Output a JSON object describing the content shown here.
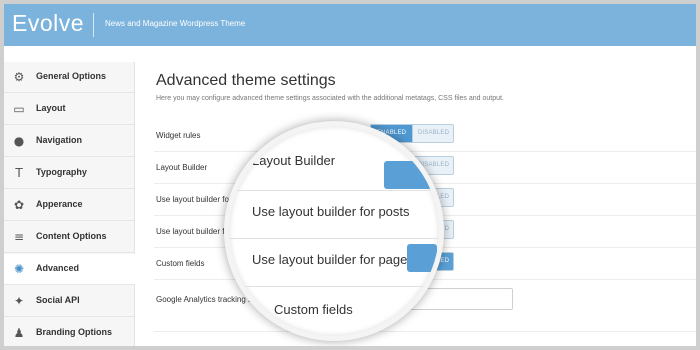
{
  "header": {
    "brand": "Evolve",
    "tagline": "News and Magazine Wordpress Theme"
  },
  "sidebar": {
    "items": [
      {
        "label": "General Options",
        "icon": "gear-icon",
        "glyph": "⚙",
        "active": false
      },
      {
        "label": "Layout",
        "icon": "monitor-icon",
        "glyph": "▭",
        "active": false
      },
      {
        "label": "Navigation",
        "icon": "mouse-icon",
        "glyph": "●",
        "active": false
      },
      {
        "label": "Typography",
        "icon": "text-icon",
        "glyph": "T",
        "active": false
      },
      {
        "label": "Apperance",
        "icon": "palette-icon",
        "glyph": "✿",
        "active": false
      },
      {
        "label": "Content Options",
        "icon": "document-icon",
        "glyph": "≡",
        "active": false
      },
      {
        "label": "Advanced",
        "icon": "cog-icon",
        "glyph": "✺",
        "active": true
      },
      {
        "label": "Social API",
        "icon": "bird-icon",
        "glyph": "✦",
        "active": false
      },
      {
        "label": "Branding Options",
        "icon": "person-icon",
        "glyph": "♟",
        "active": false
      }
    ]
  },
  "main": {
    "title": "Advanced theme settings",
    "description": "Here you may configure advanced theme settings associated with the additional metatags, CSS files and output.",
    "toggle_on": "ENABLED",
    "toggle_off": "DISABLED",
    "rows": [
      {
        "label": "Widget rules",
        "type": "toggle",
        "value": "enabled"
      },
      {
        "label": "Layout Builder",
        "type": "toggle",
        "value": "disabled"
      },
      {
        "label": "Use layout builder for posts",
        "type": "toggle",
        "value": "disabled"
      },
      {
        "label": "Use layout builder for pages",
        "type": "toggle",
        "value": "disabled"
      },
      {
        "label": "Custom fields",
        "type": "toggle",
        "value": "disabled"
      },
      {
        "label": "Google Analytics tracking ID",
        "type": "text",
        "value": ""
      }
    ]
  },
  "magnifier": {
    "labels": [
      "Layout Builder",
      "Use layout builder for posts",
      "Use layout builder for pages",
      "Custom fields"
    ]
  },
  "colors": {
    "header": "#7cb3dc",
    "accent": "#5aa0d6"
  }
}
